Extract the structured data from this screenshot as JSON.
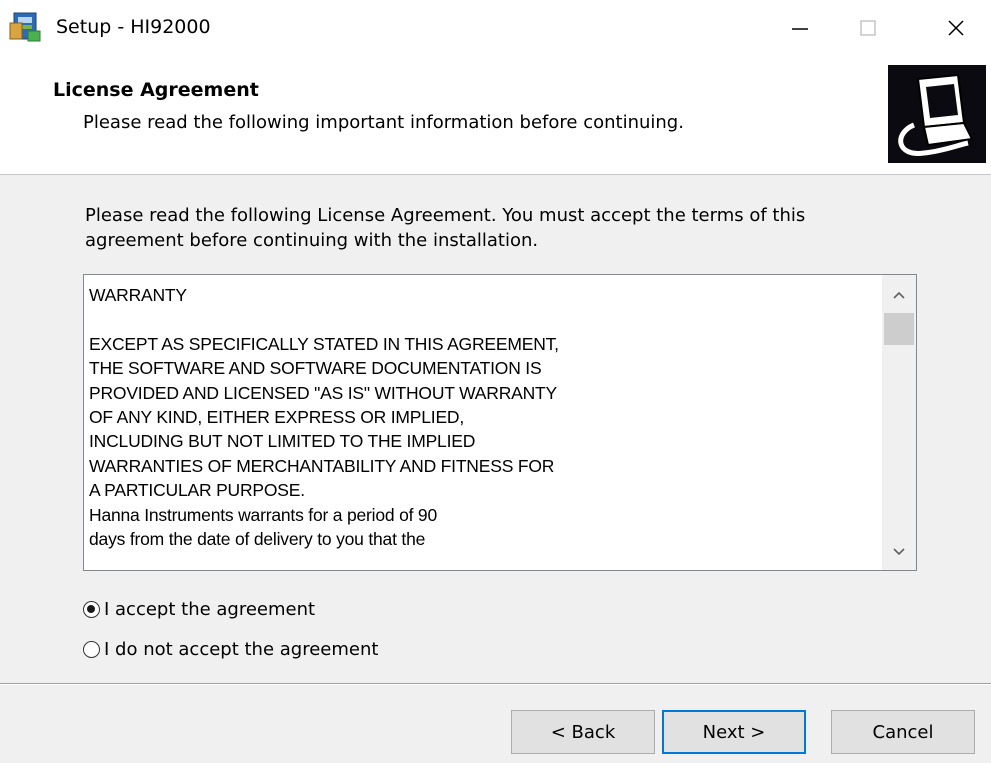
{
  "window": {
    "title": "Setup - HI92000",
    "icons": {
      "app": "setup-installer-icon",
      "minimize": "minimize-icon",
      "maximize": "maximize-icon",
      "close": "close-icon"
    }
  },
  "header": {
    "title": "License Agreement",
    "subtitle": "Please read the following important information before continuing.",
    "image": "computer-install-icon"
  },
  "intro": "Please read the following License Agreement. You must accept the terms of this agreement before continuing with the installation.",
  "license": {
    "text": "WARRANTY\n\nEXCEPT AS SPECIFICALLY STATED IN THIS AGREEMENT,\nTHE SOFTWARE AND SOFTWARE DOCUMENTATION IS\nPROVIDED AND LICENSED \"AS IS\" WITHOUT WARRANTY\nOF ANY KIND, EITHER EXPRESS OR IMPLIED,\nINCLUDING BUT NOT LIMITED TO THE IMPLIED\nWARRANTIES OF MERCHANTABILITY AND FITNESS FOR\nA PARTICULAR PURPOSE.\nHanna Instruments warrants for a period of 90\ndays from the date of delivery to you that the",
    "scroll_up_icon": "chevron-up-icon",
    "scroll_down_icon": "chevron-down-icon"
  },
  "options": {
    "accept": {
      "label": "I accept the agreement",
      "selected": true
    },
    "decline": {
      "label": "I do not accept the agreement",
      "selected": false
    }
  },
  "buttons": {
    "back": "< Back",
    "next": "Next >",
    "cancel": "Cancel"
  },
  "colors": {
    "focus_border": "#0078d7",
    "window_bg": "#f0f0f0"
  }
}
